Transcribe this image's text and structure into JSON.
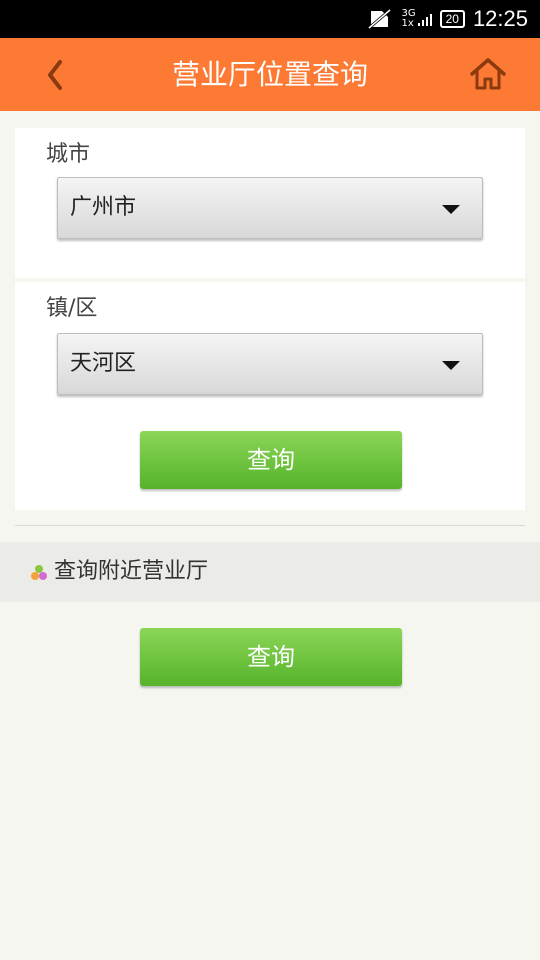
{
  "status_bar": {
    "network_top": "3G",
    "network_bottom": "1x",
    "battery": "20",
    "time": "12:25"
  },
  "header": {
    "title": "营业厅位置查询",
    "back_icon": "chevron-left-icon",
    "home_icon": "home-icon",
    "accent_color": "#fc7a34"
  },
  "city": {
    "label": "城市",
    "selected": "广州市"
  },
  "district": {
    "label": "镇/区",
    "selected": "天河区",
    "button_label": "查询"
  },
  "nearby": {
    "title": "查询附近营业厅",
    "button_label": "查询"
  }
}
